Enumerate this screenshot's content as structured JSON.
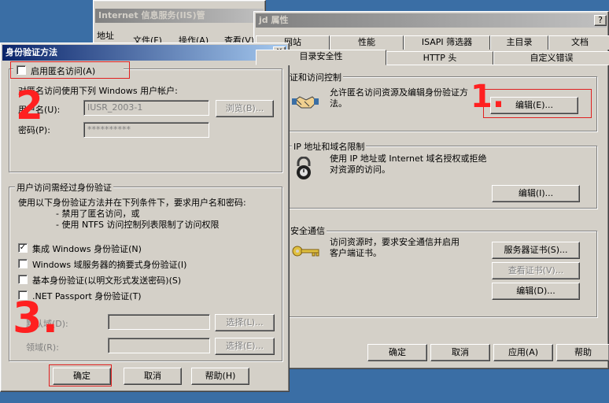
{
  "bg_window": {
    "title": "Internet 信息服务(IIS)管",
    "address_label": "地址",
    "menu": [
      "文件(F)",
      "操作(A)",
      "查看(V)"
    ]
  },
  "props": {
    "title": "jd 属性",
    "help_btn": "?",
    "tabs_row1": [
      "网站",
      "性能",
      "ISAPI 筛选器",
      "主目录",
      "文档"
    ],
    "tabs_row2": [
      "目录安全性",
      "HTTP 头",
      "自定义错误"
    ],
    "auth_group": {
      "title": "身份验证和访问控制",
      "desc": "允许匿名访问资源及编辑身份验证方法。",
      "edit": "编辑(E)..."
    },
    "ip_group": {
      "title": "IP 地址和域名限制",
      "desc": "使用 IP 地址或 Internet 域名授权或拒绝对资源的访问。",
      "edit": "编辑(I)..."
    },
    "secure_group": {
      "title": "安全通信",
      "desc": "访问资源时，要求安全通信并启用客户端证书。",
      "server_cert": "服务器证书(S)...",
      "view_cert": "查看证书(V)...",
      "edit": "编辑(D)..."
    },
    "buttons": {
      "ok": "确定",
      "cancel": "取消",
      "apply": "应用(A)",
      "help": "帮助"
    }
  },
  "auth": {
    "title": "身份验证方法",
    "close": "✕",
    "anon_checkbox": "启用匿名访问(A)",
    "anon_desc": "对匿名访问使用下列 Windows 用户帐户:",
    "username_label": "用户名(U):",
    "username_value": "IUSR_2003-1",
    "browse": "浏览(B)...",
    "password_label": "密码(P):",
    "password_value": "**********",
    "auth_group_title": "用户访问需经过身份验证",
    "auth_desc1": "使用以下身份验证方法并在下列条件下，要求用户名和密码:",
    "auth_desc2": "- 禁用了匿名访问，或",
    "auth_desc3": "- 使用 NTFS 访问控制列表限制了访问权限",
    "methods": [
      {
        "label": "集成 Windows 身份验证(N)",
        "checked": true
      },
      {
        "label": "Windows 域服务器的摘要式身份验证(I)",
        "checked": false
      },
      {
        "label": "基本身份验证(以明文形式发送密码)(S)",
        "checked": false
      },
      {
        "label": ".NET Passport 身份验证(T)",
        "checked": false
      }
    ],
    "default_domain_label": "默认域(D):",
    "realm_label": "领域(R):",
    "select1": "选择(L)...",
    "select2": "选择(E)...",
    "ok": "确定",
    "cancel": "取消",
    "help": "帮助(H)"
  },
  "annotations": {
    "a1": "1.",
    "a2": "2",
    "a3": "3."
  }
}
